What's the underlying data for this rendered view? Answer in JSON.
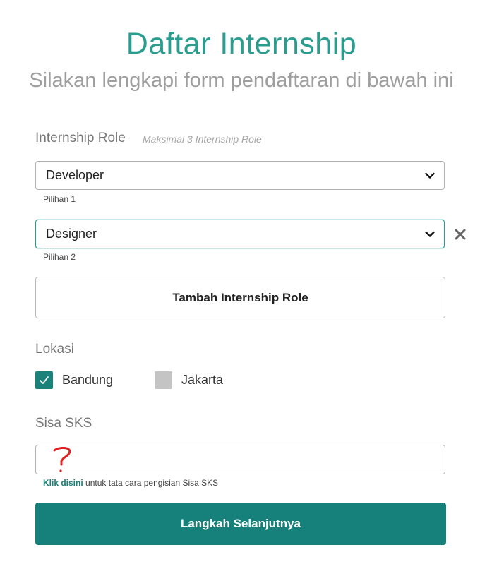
{
  "header": {
    "title": "Daftar Internship",
    "subtitle": "Silakan lengkapi form pendaftaran di bawah ini"
  },
  "roles": {
    "label": "Internship Role",
    "hint": "Maksimal 3 Internship Role",
    "choices": [
      {
        "value": "Developer",
        "caption": "Pilihan 1"
      },
      {
        "value": "Designer",
        "caption": "Pilihan 2"
      }
    ],
    "add_label": "Tambah Internship Role"
  },
  "location": {
    "label": "Lokasi",
    "options": [
      {
        "label": "Bandung",
        "checked": true
      },
      {
        "label": "Jakarta",
        "checked": false
      }
    ]
  },
  "sks": {
    "label": "Sisa SKS",
    "value": "",
    "help_link": "Klik disini",
    "help_text": " untuk tata cara pengisian Sisa SKS"
  },
  "submit": {
    "label": "Langkah Selanjutnya"
  },
  "colors": {
    "accent": "#2a9d8f",
    "primary_button": "#16807a",
    "annotation": "#e02020"
  },
  "icons": {
    "dropdown": "chevron-down-icon",
    "remove": "close-icon",
    "checkmark": "check-icon",
    "annotation": "question-mark-annotation"
  }
}
